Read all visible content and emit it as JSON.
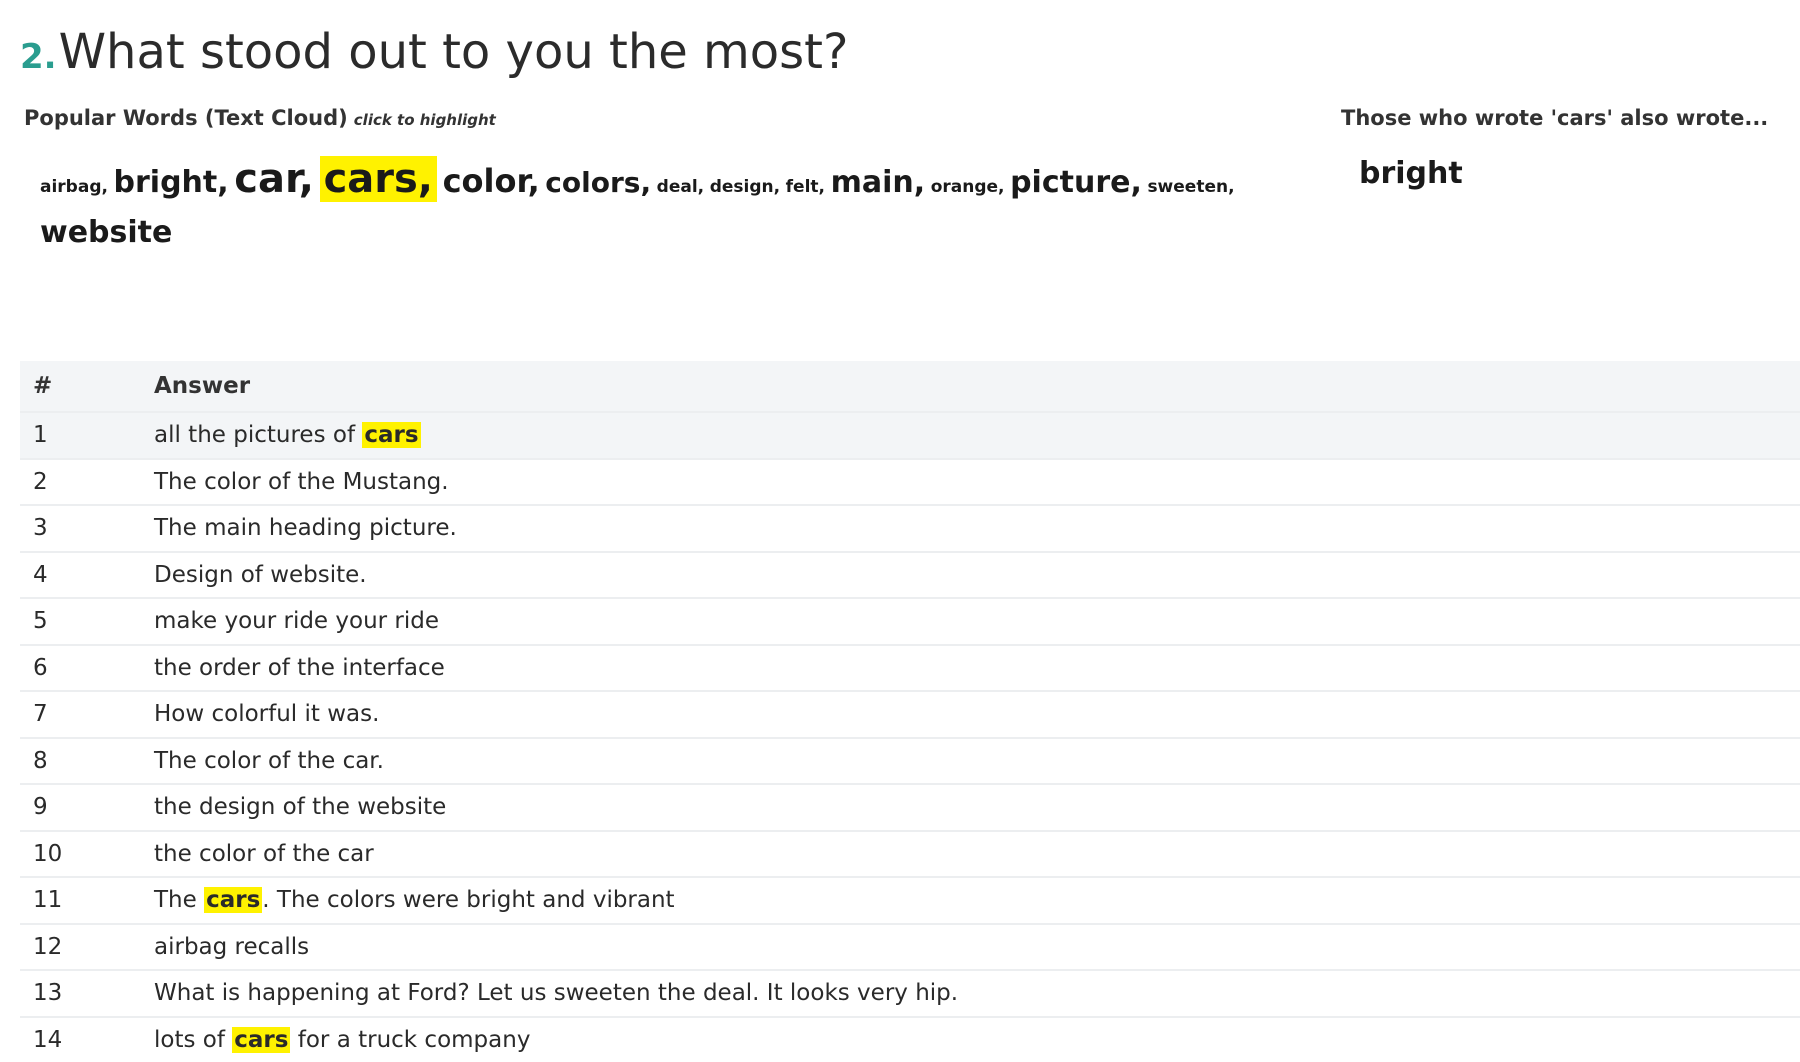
{
  "question": {
    "number": "2.",
    "title": "What stood out to you the most?"
  },
  "text_cloud": {
    "heading": "Popular Words (Text Cloud)",
    "hint": "click to highlight",
    "highlight_color": "#fff200",
    "words": [
      {
        "text": "airbag,",
        "size": 17
      },
      {
        "text": "bright,",
        "size": 30
      },
      {
        "text": "car,",
        "size": 40
      },
      {
        "text": "cars,",
        "size": 40,
        "highlighted": true
      },
      {
        "text": "color,",
        "size": 32
      },
      {
        "text": "colors,",
        "size": 28
      },
      {
        "text": "deal,",
        "size": 17
      },
      {
        "text": "design,",
        "size": 17
      },
      {
        "text": "felt,",
        "size": 17
      },
      {
        "text": "main,",
        "size": 30
      },
      {
        "text": "orange,",
        "size": 17
      },
      {
        "text": "picture,",
        "size": 30
      },
      {
        "text": "sweeten,",
        "size": 17
      },
      {
        "text": "website",
        "size": 30
      }
    ]
  },
  "also_wrote": {
    "heading": "Those who wrote 'cars' also wrote...",
    "words": [
      "bright"
    ]
  },
  "answers_table": {
    "headers": {
      "num": "#",
      "answer": "Answer"
    },
    "rows": [
      {
        "num": "1",
        "parts": [
          {
            "t": "all the pictures of "
          },
          {
            "t": "cars",
            "hl": true
          }
        ]
      },
      {
        "num": "2",
        "parts": [
          {
            "t": "The color of the Mustang."
          }
        ]
      },
      {
        "num": "3",
        "parts": [
          {
            "t": "The main heading picture."
          }
        ]
      },
      {
        "num": "4",
        "parts": [
          {
            "t": "Design of website."
          }
        ]
      },
      {
        "num": "5",
        "parts": [
          {
            "t": "make your ride your ride"
          }
        ]
      },
      {
        "num": "6",
        "parts": [
          {
            "t": "the order of the interface"
          }
        ]
      },
      {
        "num": "7",
        "parts": [
          {
            "t": "How colorful it was."
          }
        ]
      },
      {
        "num": "8",
        "parts": [
          {
            "t": "The color of the car."
          }
        ]
      },
      {
        "num": "9",
        "parts": [
          {
            "t": "the design of the website"
          }
        ]
      },
      {
        "num": "10",
        "parts": [
          {
            "t": "the color of the car"
          }
        ]
      },
      {
        "num": "11",
        "parts": [
          {
            "t": "The "
          },
          {
            "t": "cars",
            "hl": true
          },
          {
            "t": ". The colors were bright and vibrant"
          }
        ]
      },
      {
        "num": "12",
        "parts": [
          {
            "t": "airbag recalls"
          }
        ]
      },
      {
        "num": "13",
        "parts": [
          {
            "t": "What is happening at Ford? Let us sweeten the deal. It looks very hip."
          }
        ]
      },
      {
        "num": "14",
        "parts": [
          {
            "t": "lots of "
          },
          {
            "t": "cars",
            "hl": true
          },
          {
            "t": " for a truck company"
          }
        ]
      }
    ]
  }
}
